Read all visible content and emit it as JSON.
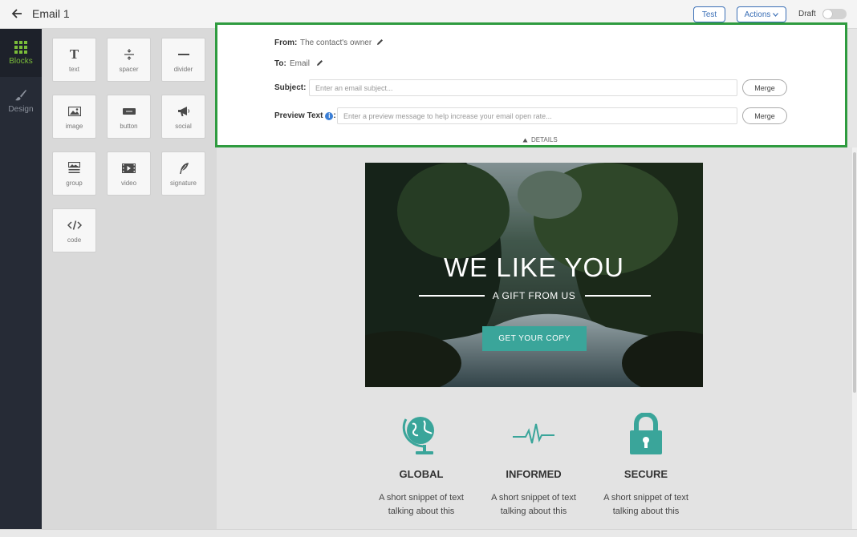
{
  "topbar": {
    "title": "Email 1",
    "test_label": "Test",
    "actions_label": "Actions",
    "draft_label": "Draft"
  },
  "sidenav": {
    "blocks_label": "Blocks",
    "design_label": "Design"
  },
  "blocks": [
    {
      "label": "text",
      "icon": "text-icon"
    },
    {
      "label": "spacer",
      "icon": "spacer-icon"
    },
    {
      "label": "divider",
      "icon": "divider-icon"
    },
    {
      "label": "image",
      "icon": "image-icon"
    },
    {
      "label": "button",
      "icon": "button-icon"
    },
    {
      "label": "social",
      "icon": "megaphone-icon"
    },
    {
      "label": "group",
      "icon": "group-icon"
    },
    {
      "label": "video",
      "icon": "video-icon"
    },
    {
      "label": "signature",
      "icon": "feather-icon"
    },
    {
      "label": "code",
      "icon": "code-icon"
    }
  ],
  "header": {
    "from_label": "From:",
    "from_value": "The contact's owner",
    "to_label": "To:",
    "to_value": "Email",
    "subject_label": "Subject:",
    "subject_placeholder": "Enter an email subject...",
    "preview_label": "Preview Text",
    "preview_placeholder": "Enter a preview message to help increase your email open rate...",
    "merge_label": "Merge",
    "details_label": "DETAILS"
  },
  "email": {
    "hero_title": "WE LIKE YOU",
    "hero_subtitle": "A GIFT FROM US",
    "hero_button": "GET YOUR COPY",
    "features": [
      {
        "title": "GLOBAL",
        "text": "A short snippet of text talking about this",
        "icon": "globe-icon"
      },
      {
        "title": "INFORMED",
        "text": "A short snippet of text talking about this",
        "icon": "heartbeat-icon"
      },
      {
        "title": "SECURE",
        "text": "A short snippet of text talking about this",
        "icon": "lock-icon"
      }
    ]
  },
  "colors": {
    "accent_green": "#7bbd3a",
    "panel_border": "#2e9b3f",
    "teal": "#3aa59a",
    "link_blue": "#3b6fb6"
  }
}
